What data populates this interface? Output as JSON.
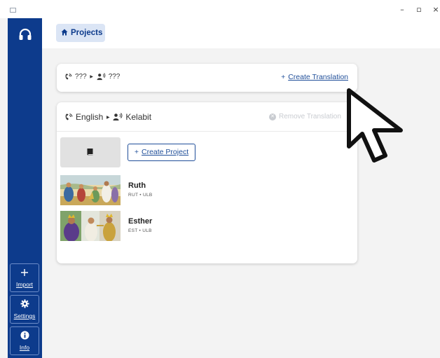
{
  "window": {
    "controls": {
      "minimize": "–",
      "maximize": "▫",
      "close": "×"
    }
  },
  "sidebar": {
    "logo_icon": "headphones-icon",
    "import_label": "Import",
    "settings_label": "Settings",
    "info_label": "Info"
  },
  "header": {
    "projects_label": "Projects",
    "projects_icon": "home-icon"
  },
  "new_translation": {
    "source_language": "???",
    "target_language": "???",
    "create_label": "Create Translation",
    "create_prefix": "+"
  },
  "translation": {
    "source_language": "English",
    "target_language": "Kelabit",
    "remove_label": "Remove Translation",
    "create_project_label": "Create Project",
    "create_project_prefix": "+",
    "books": [
      {
        "title": "Ruth",
        "code": "RUT",
        "resource": "ULB",
        "separator": "•"
      },
      {
        "title": "Esther",
        "code": "EST",
        "resource": "ULB",
        "separator": "•"
      }
    ]
  },
  "colors": {
    "sidebar": "#0d3b8c",
    "accent": "#1f4e99",
    "chip_bg": "#dbe5f5",
    "background": "#f3f3f3"
  }
}
